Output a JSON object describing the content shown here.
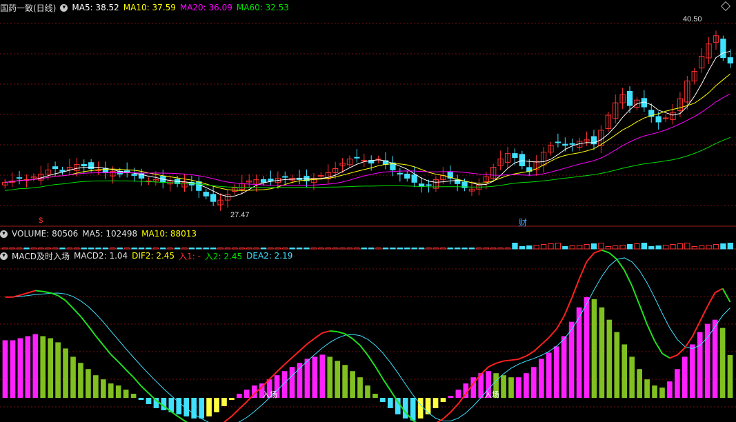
{
  "main_header": {
    "title": "国药一致(日线)",
    "items": [
      {
        "text": "MA5: 38.52",
        "color": "#ffffff"
      },
      {
        "text": "MA10: 37.59",
        "color": "#ffff00"
      },
      {
        "text": "MA20: 36.09",
        "color": "#ff00ff"
      },
      {
        "text": "MA60: 32.53",
        "color": "#00e000"
      }
    ]
  },
  "price_labels": {
    "high": "40.50",
    "low": "27.47"
  },
  "markers": {
    "dividend": "$",
    "finance": "财"
  },
  "volume_header": {
    "items": [
      {
        "text": "VOLUME: 80506",
        "color": "#e0e0e0"
      },
      {
        "text": "MA5: 102498",
        "color": "#e0e0e0"
      },
      {
        "text": "MA10: 88013",
        "color": "#e0e0e0"
      }
    ]
  },
  "macd_header": {
    "title": "MACD及时入场",
    "items": [
      {
        "text": "MACD2: 1.04",
        "color": "#e0e0e0"
      },
      {
        "text": "DIF2: 2.45",
        "color": "#ffff00"
      },
      {
        "text": "入1: -",
        "color": "#ff3030"
      },
      {
        "text": "入2: 2.45",
        "color": "#00e000"
      },
      {
        "text": "DEA2: 2.19",
        "color": "#40e0ff"
      }
    ]
  },
  "entry_labels": [
    "入场",
    "入场"
  ],
  "colors": {
    "up": "#ff3030",
    "down": "#40e0ff",
    "ma5": "#ffffff",
    "ma10": "#ffff00",
    "ma20": "#ff00ff",
    "ma60": "#00e000",
    "grid": "#7a1010"
  },
  "chart_data": {
    "type": "candlestick",
    "price_range": [
      26.5,
      41.5
    ],
    "closes": [
      29.2,
      29.3,
      29.5,
      29.4,
      29.6,
      29.8,
      30.1,
      30.2,
      30.0,
      30.3,
      30.5,
      30.4,
      30.2,
      30.1,
      29.9,
      30.0,
      29.8,
      29.9,
      29.7,
      29.5,
      29.3,
      29.4,
      29.2,
      29.3,
      29.1,
      29.2,
      29.0,
      28.6,
      28.2,
      27.8,
      27.9,
      28.3,
      28.8,
      29.1,
      29.3,
      29.4,
      29.2,
      29.3,
      29.5,
      29.6,
      29.5,
      29.4,
      29.3,
      29.5,
      29.7,
      29.9,
      30.2,
      30.6,
      30.9,
      31.0,
      30.8,
      30.6,
      30.9,
      30.5,
      30.1,
      29.8,
      29.5,
      29.2,
      28.9,
      29.0,
      29.4,
      29.7,
      29.5,
      29.1,
      28.8,
      28.7,
      29.0,
      29.6,
      30.3,
      30.9,
      31.3,
      31.0,
      30.4,
      30.0,
      30.7,
      31.4,
      31.9,
      32.1,
      31.9,
      32.0,
      32.2,
      32.3,
      32.0,
      33.0,
      34.1,
      35.0,
      35.6,
      34.8,
      35.2,
      34.7,
      34.0,
      33.6,
      33.9,
      34.3,
      35.3,
      36.6,
      37.3,
      38.4,
      39.3,
      39.9,
      38.3,
      37.9
    ],
    "macd_hist": [
      1.4,
      1.4,
      1.45,
      1.5,
      1.55,
      1.5,
      1.45,
      1.35,
      1.2,
      1.0,
      0.85,
      0.7,
      0.55,
      0.45,
      0.35,
      0.3,
      0.2,
      0.1,
      -0.05,
      -0.15,
      -0.25,
      -0.3,
      -0.35,
      -0.4,
      -0.45,
      -0.5,
      -0.5,
      -0.45,
      -0.35,
      -0.2,
      -0.05,
      0.1,
      0.2,
      0.3,
      0.35,
      0.45,
      0.55,
      0.65,
      0.75,
      0.85,
      0.95,
      1.0,
      1.05,
      1.0,
      0.9,
      0.8,
      0.65,
      0.5,
      0.3,
      0.1,
      -0.1,
      -0.25,
      -0.4,
      -0.5,
      -0.55,
      -0.5,
      -0.4,
      -0.25,
      -0.1,
      0.05,
      0.2,
      0.35,
      0.5,
      0.6,
      0.65,
      0.6,
      0.55,
      0.5,
      0.5,
      0.6,
      0.75,
      0.95,
      1.1,
      1.25,
      1.5,
      1.85,
      2.2,
      2.45,
      2.4,
      2.2,
      1.9,
      1.6,
      1.3,
      1.0,
      0.7,
      0.45,
      0.3,
      0.25,
      0.4,
      0.7,
      1.0,
      1.3,
      1.6,
      1.8,
      1.9,
      1.7,
      1.04
    ]
  }
}
